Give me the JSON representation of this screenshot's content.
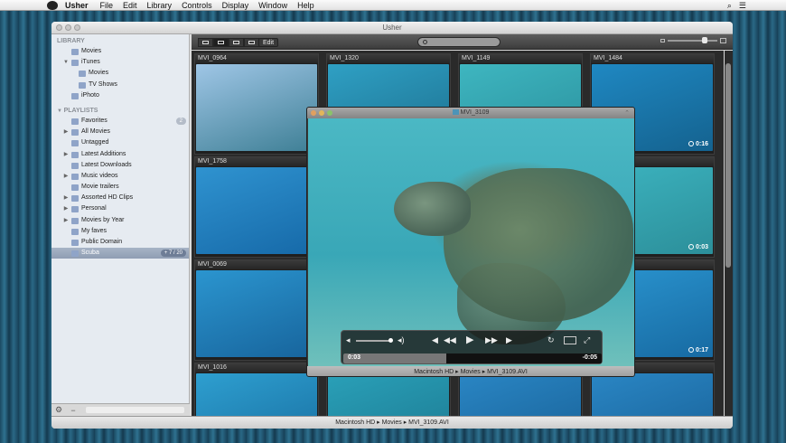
{
  "menubar": {
    "app": "Usher",
    "items": [
      "File",
      "Edit",
      "Library",
      "Controls",
      "Display",
      "Window",
      "Help"
    ]
  },
  "window": {
    "title": "Usher"
  },
  "sidebar": {
    "library_header": "LIBRARY",
    "library": [
      {
        "label": "Movies",
        "count": "",
        "indent": 1,
        "disclosure": ""
      },
      {
        "label": "iTunes",
        "count": "",
        "indent": 1,
        "disclosure": "▼"
      },
      {
        "label": "Movies",
        "count": "",
        "indent": 2,
        "disclosure": ""
      },
      {
        "label": "TV Shows",
        "count": "",
        "indent": 2,
        "disclosure": ""
      },
      {
        "label": "iPhoto",
        "count": "",
        "indent": 1,
        "disclosure": ""
      }
    ],
    "playlists_header": "PLAYLISTS",
    "playlists": [
      {
        "label": "Favorites",
        "count": "2",
        "disclosure": ""
      },
      {
        "label": "All Movies",
        "count": "",
        "disclosure": "▶"
      },
      {
        "label": "Untagged",
        "count": "",
        "disclosure": ""
      },
      {
        "label": "Latest Additions",
        "count": "",
        "disclosure": "▶"
      },
      {
        "label": "Latest Downloads",
        "count": "",
        "disclosure": ""
      },
      {
        "label": "Music videos",
        "count": "",
        "disclosure": "▶"
      },
      {
        "label": "Movie trailers",
        "count": "",
        "disclosure": ""
      },
      {
        "label": "Assorted HD Clips",
        "count": "",
        "disclosure": "▶"
      },
      {
        "label": "Personal",
        "count": "",
        "disclosure": "▶"
      },
      {
        "label": "Movies by Year",
        "count": "",
        "disclosure": "▶"
      },
      {
        "label": "My faves",
        "count": "",
        "disclosure": ""
      },
      {
        "label": "Public Domain",
        "count": "",
        "disclosure": ""
      },
      {
        "label": "Scuba",
        "count": "+ 7 / 20",
        "disclosure": "",
        "selected": true
      }
    ],
    "bottom": {
      "gear": "⚙",
      "minus": "−"
    }
  },
  "toolbar": {
    "edit_label": "Edit"
  },
  "tiles": [
    {
      "label": "MVI_0964",
      "duration": "",
      "colorA": "#9fc6e6",
      "colorB": "#3e7f95"
    },
    {
      "label": "MVI_1320",
      "duration": "",
      "colorA": "#2fa0c4",
      "colorB": "#1c6f8e"
    },
    {
      "label": "MVI_1149",
      "duration": "",
      "colorA": "#3eb6c0",
      "colorB": "#2a8f9c"
    },
    {
      "label": "MVI_1484",
      "duration": "0:16",
      "colorA": "#1f88c2",
      "colorB": "#14628f"
    },
    {
      "label": "MVI_1758",
      "duration": "",
      "colorA": "#2f93d0",
      "colorB": "#1669a8"
    },
    {
      "label": "",
      "duration": "",
      "colorA": "#2b86c2",
      "colorB": "#195e92"
    },
    {
      "label": "",
      "duration": "",
      "colorA": "#2b86c2",
      "colorB": "#195e92"
    },
    {
      "label": "",
      "duration": "0:03",
      "colorA": "#3cb3bf",
      "colorB": "#2c8f9a"
    },
    {
      "label": "MVI_0069",
      "duration": "",
      "colorA": "#2b95cf",
      "colorB": "#17649c"
    },
    {
      "label": "",
      "duration": "",
      "colorA": "#2b86c2",
      "colorB": "#195e92"
    },
    {
      "label": "",
      "duration": "",
      "colorA": "#2b86c2",
      "colorB": "#195e92"
    },
    {
      "label": "",
      "duration": "0:17",
      "colorA": "#2a94cf",
      "colorB": "#176aa2"
    },
    {
      "label": "MVI_1016",
      "duration": "",
      "colorA": "#2e9fd0",
      "colorB": "#176c9e"
    },
    {
      "label": "",
      "duration": "",
      "colorA": "#2aa0b8",
      "colorB": "#1b7890"
    },
    {
      "label": "",
      "duration": "",
      "colorA": "#2a86c4",
      "colorB": "#175f95"
    },
    {
      "label": "",
      "duration": "",
      "colorA": "#2a86c4",
      "colorB": "#175f95"
    }
  ],
  "player": {
    "title": "MVI_3109",
    "current_time": "0:03",
    "remaining_time": "-0:05",
    "progress": 0.4,
    "path": "Macintosh HD ▸ Movies ▸ MVI_3109.AVI"
  },
  "statusbar": {
    "path": "Macintosh HD ▸ Movies ▸ MVI_3109.AVI"
  }
}
